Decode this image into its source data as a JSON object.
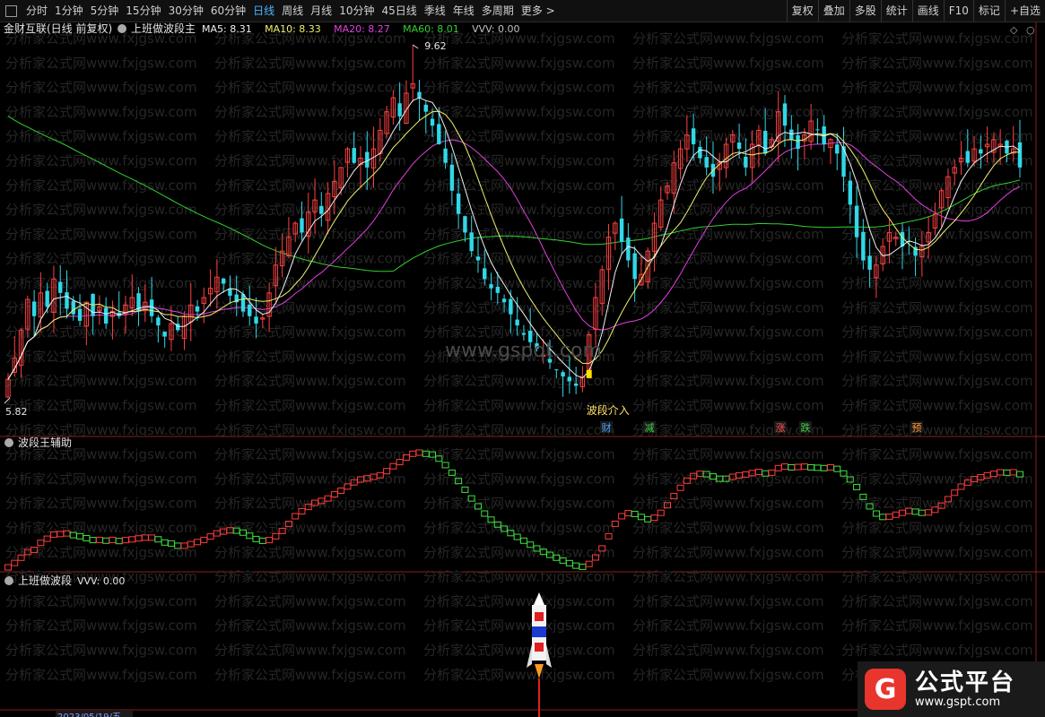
{
  "toolbar": {
    "periods": [
      "分时",
      "1分钟",
      "5分钟",
      "15分钟",
      "30分钟",
      "60分钟",
      "日线",
      "周线",
      "月线",
      "10分钟",
      "45日线",
      "季线",
      "年线",
      "多周期",
      "更多 >"
    ],
    "active_index": 6,
    "right": [
      "复权",
      "叠加",
      "多股",
      "统计",
      "画线",
      "F10",
      "标记",
      "+自选"
    ]
  },
  "main_panel": {
    "stock_label": "金财互联(日线 前复权)",
    "indicator_name": "上班做波段主",
    "legend": [
      {
        "label": "MA5: 8.31",
        "color": "#f0f0f0"
      },
      {
        "label": "MA10: 8.33",
        "color": "#f0f070"
      },
      {
        "label": "MA20: 8.27",
        "color": "#e040e0"
      },
      {
        "label": "MA60: 8.01",
        "color": "#30d030"
      },
      {
        "label": "VVV: 0.00",
        "color": "#c0c0c0"
      }
    ],
    "high_label": "9.62",
    "low_label": "5.82",
    "signal_text": "波段介入",
    "watermark_center": "www.gspqt.com",
    "watermark_tile": "分析家公式网www.fxjgsw.com",
    "event_tags": [
      {
        "text": "财",
        "color": "#4aa0ff"
      },
      {
        "text": "减",
        "color": "#40d040"
      },
      {
        "text": "涨",
        "color": "#ff5050"
      },
      {
        "text": "跌",
        "color": "#40d040"
      },
      {
        "text": "预",
        "color": "#ff9a30"
      }
    ]
  },
  "panel2": {
    "title": "波段王辅助"
  },
  "panel3": {
    "title": "上班做波段",
    "legend": "VVV: 0.00"
  },
  "bottom_axis": {
    "date_label": "2023/05/19/五"
  },
  "logo": {
    "glyph": "G",
    "cn": "公式平台",
    "en": "www.gspt.com"
  },
  "colors": {
    "up": "#ff4040",
    "down": "#30d8e8",
    "ma5": "#f0f0f0",
    "ma10": "#f0f070",
    "ma20": "#e040e0",
    "ma60": "#30d030"
  },
  "chart_data": {
    "type": "candlestick",
    "price_range": [
      5.82,
      9.62
    ],
    "closes": [
      6.02,
      6.25,
      6.55,
      6.88,
      6.7,
      6.95,
      6.8,
      7.1,
      6.95,
      6.78,
      6.72,
      6.65,
      6.85,
      6.7,
      6.8,
      6.62,
      6.75,
      6.7,
      6.82,
      6.9,
      6.75,
      6.85,
      6.7,
      6.6,
      6.48,
      6.62,
      6.55,
      6.7,
      6.82,
      6.75,
      6.9,
      7.0,
      7.12,
      7.05,
      6.92,
      6.85,
      6.75,
      6.7,
      6.62,
      6.68,
      6.95,
      7.25,
      7.4,
      7.55,
      7.7,
      7.6,
      7.82,
      7.95,
      7.8,
      8.02,
      8.15,
      8.3,
      8.5,
      8.35,
      8.4,
      8.3,
      8.5,
      8.7,
      8.9,
      9.05,
      8.85,
      9.1,
      9.2,
      9.05,
      8.9,
      8.75,
      8.55,
      8.35,
      8.05,
      7.8,
      7.6,
      7.4,
      7.3,
      7.1,
      7.0,
      6.95,
      6.85,
      6.72,
      6.6,
      6.5,
      6.42,
      6.35,
      6.28,
      6.2,
      6.12,
      6.05,
      6.0,
      5.95,
      6.05,
      6.5,
      6.9,
      7.2,
      7.55,
      7.7,
      7.5,
      7.3,
      7.1,
      7.15,
      7.4,
      7.7,
      7.95,
      8.1,
      8.35,
      8.5,
      8.65,
      8.55,
      8.4,
      8.3,
      8.2,
      8.35,
      8.55,
      8.65,
      8.5,
      8.3,
      8.55,
      8.7,
      8.45,
      8.6,
      8.9,
      8.75,
      8.6,
      8.5,
      8.65,
      8.8,
      8.7,
      8.55,
      8.6,
      8.45,
      8.2,
      7.9,
      7.55,
      7.3,
      7.2,
      7.25,
      7.45,
      7.6,
      7.55,
      7.45,
      7.5,
      7.35,
      7.45,
      7.6,
      7.8,
      8.05,
      8.2,
      8.3,
      8.4,
      8.35,
      8.5,
      8.45,
      8.55,
      8.6,
      8.55,
      8.45,
      8.5,
      8.3
    ]
  }
}
